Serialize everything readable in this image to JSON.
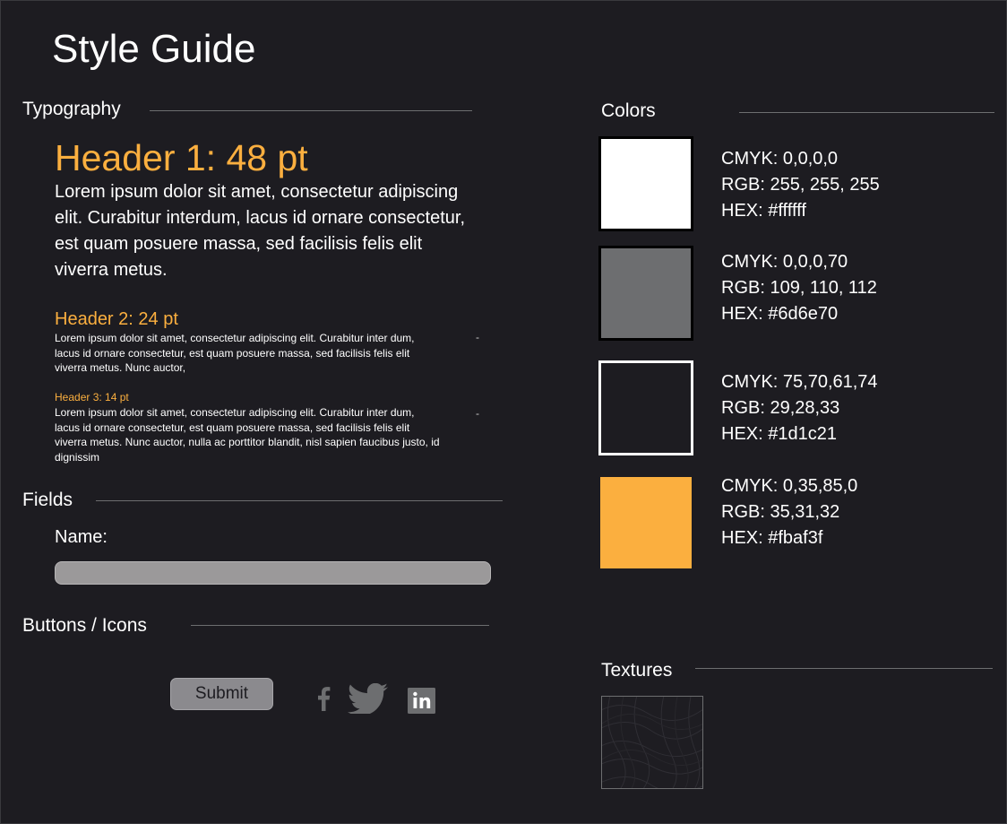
{
  "page": {
    "title": "Style Guide"
  },
  "typography": {
    "heading": "Typography",
    "header1": "Header 1: 48 pt",
    "body1": "Lorem ipsum dolor sit amet, consectetur adipiscing elit. Curabitur interdum, lacus id ornare consectetur, est quam posuere massa, sed facilisis felis elit viverra metus.",
    "header2": "Header 2: 24 pt",
    "body2": "Lorem ipsum dolor sit amet, consectetur adipiscing elit. Curabitur inter dum, lacus id ornare consectetur, est quam posuere massa, sed facilisis felis elit viverra metus. Nunc auctor,",
    "header3": "Header 3: 14 pt",
    "body3": "Lorem ipsum dolor sit amet, consectetur adipiscing elit. Curabitur inter dum, lacus id ornare consectetur, est quam posuere massa, sed facilisis felis elit viverra metus. Nunc auctor, nulla ac porttitor blandit, nisl sapien faucibus justo, id dignissim",
    "stray_dash": "-"
  },
  "fields": {
    "heading": "Fields",
    "name_label": "Name:",
    "name_value": ""
  },
  "buttons": {
    "heading": "Buttons / Icons",
    "submit_label": "Submit",
    "icons": [
      "facebook-icon",
      "twitter-icon",
      "linkedin-icon"
    ]
  },
  "colors": {
    "heading": "Colors",
    "swatches": [
      {
        "hex_color": "#ffffff",
        "cmyk": "CMYK: 0,0,0,0",
        "rgb": "RGB: 255, 255, 255",
        "hex": "HEX: #ffffff"
      },
      {
        "hex_color": "#6d6e70",
        "cmyk": "CMYK: 0,0,0,70",
        "rgb": "RGB: 109, 110, 112",
        "hex": "HEX: #6d6e70"
      },
      {
        "hex_color": "#1d1c21",
        "cmyk": "CMYK: 75,70,61,74",
        "rgb": "RGB: 29,28,33",
        "hex": "HEX: #1d1c21"
      },
      {
        "hex_color": "#fbaf3f",
        "cmyk": "CMYK: 0,35,85,0",
        "rgb": "RGB: 35,31,32",
        "hex": "HEX: #fbaf3f"
      }
    ]
  },
  "textures": {
    "heading": "Textures"
  },
  "theme": {
    "background": "#1d1c21",
    "accent": "#fbaf3f",
    "rule": "#6d6e70"
  }
}
